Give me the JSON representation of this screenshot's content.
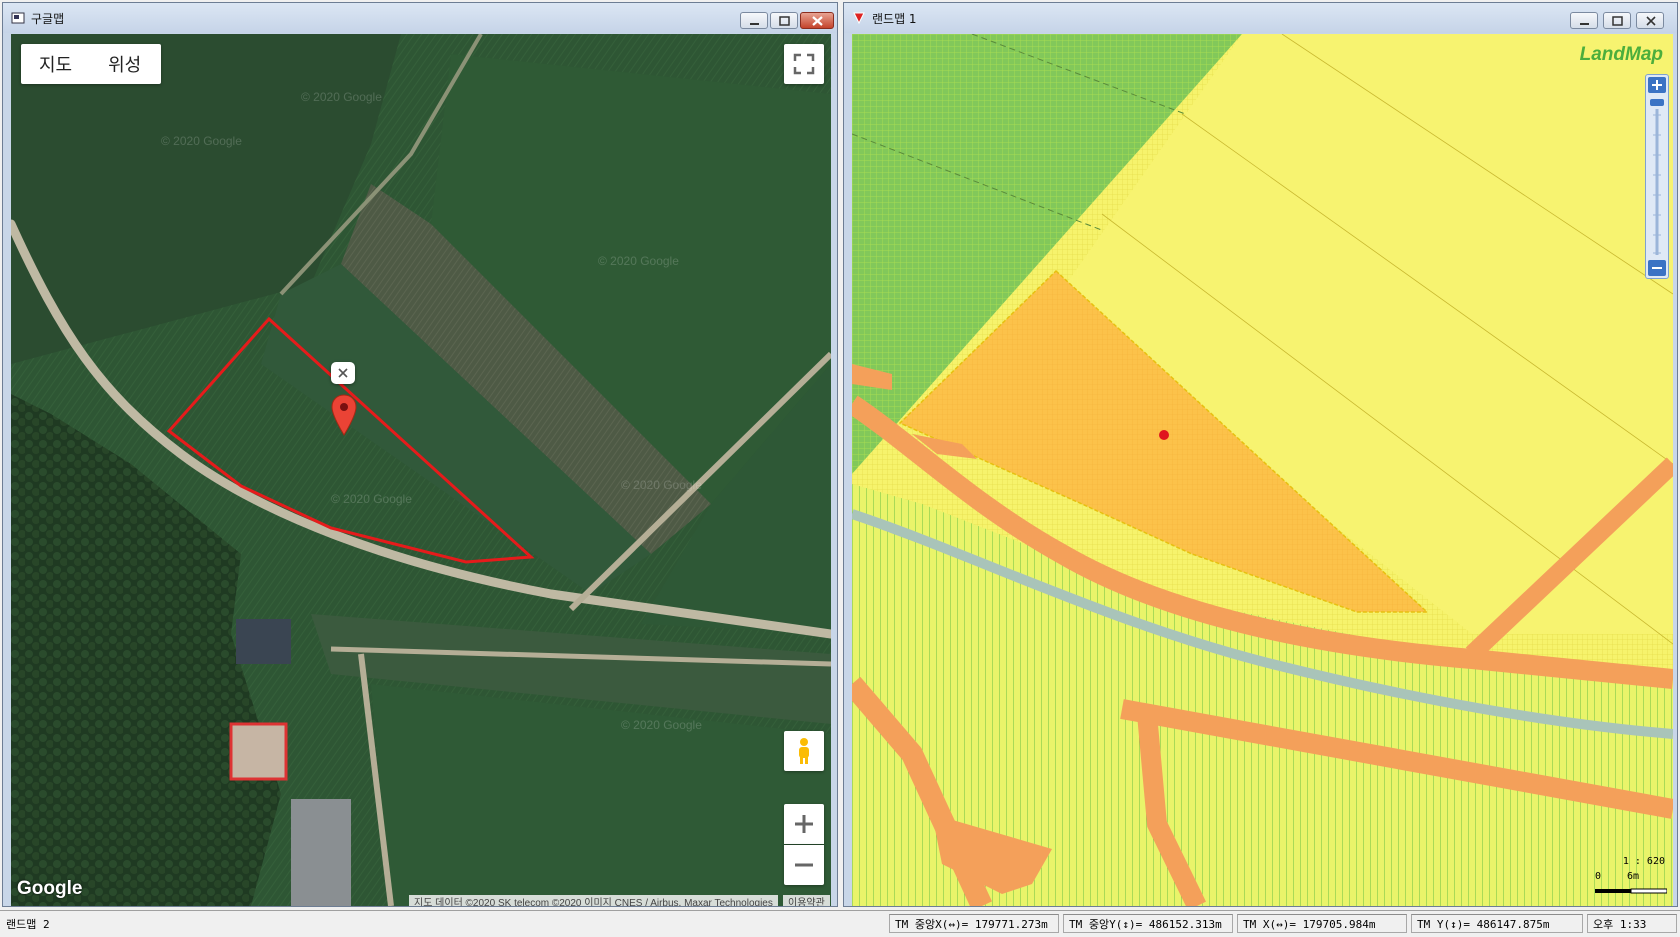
{
  "google_window": {
    "title": "구글맵",
    "maptype": {
      "map": "지도",
      "satellite": "위성"
    },
    "logo": "Google",
    "attribution": "지도 데이터 ©2020 SK telecom ©2020 이미지 CNES / Airbus, Maxar Technologies",
    "terms": "이용약관",
    "watermark": "© 2020 Google",
    "icons": [
      "fullscreen-icon",
      "pegman-icon",
      "zoom-in-icon",
      "zoom-out-icon",
      "map-marker-icon",
      "close-icon"
    ]
  },
  "land_window": {
    "title": "랜드맵 1",
    "logo": "LandMap",
    "scale": {
      "ratio": "1 : 620",
      "zero": "0",
      "distance": "6m"
    },
    "colors": {
      "parcel_selected": "#f9c046",
      "road": "#f4a05a",
      "green_zone": "#7cc85c",
      "yellow_zone": "#f5f06a",
      "marker": "#e0161e"
    }
  },
  "statusbar": {
    "label": "랜드맵 2",
    "tm_center_x": "TM 중앙X(↔)= 179771.273m",
    "tm_center_y": "TM 중앙Y(↕)= 486152.313m",
    "tm_x": "TM X(↔)= 179705.984m",
    "tm_y": "TM Y(↕)= 486147.875m",
    "time": "오후 1:33"
  }
}
